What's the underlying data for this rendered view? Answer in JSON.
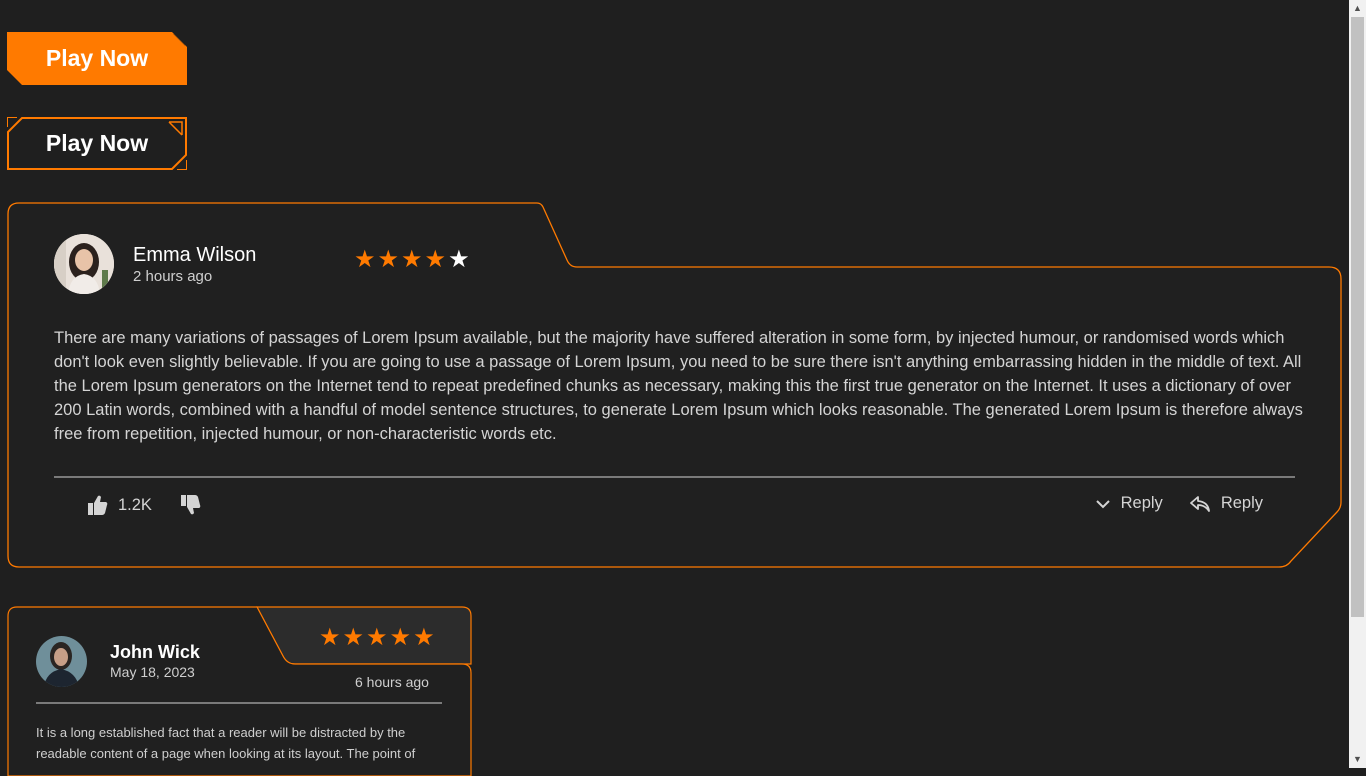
{
  "buttons": {
    "play_filled_label": "Play Now",
    "play_outline_label": "Play Now"
  },
  "colors": {
    "accent": "#ff7a00",
    "background": "#1f1f1f",
    "card_background": "#202020",
    "divider": "#7a7a7a"
  },
  "review1": {
    "name": "Emma Wilson",
    "time": "2 hours ago",
    "rating": 4,
    "rating_max": 5,
    "body": "There are many variations of passages of Lorem Ipsum available, but the majority have suffered alteration in some form, by injected humour, or randomised words which don't look even slightly believable. If you are going to use a passage of Lorem Ipsum, you need to be sure there isn't anything embarrassing hidden in the middle of text. All the Lorem Ipsum generators on the Internet tend to repeat predefined chunks as necessary, making this the first true generator on the Internet. It uses a dictionary of over 200 Latin words, combined with a handful of model sentence structures, to generate Lorem Ipsum which looks reasonable. The generated Lorem Ipsum is therefore always free from repetition, injected humour, or non-characteristic words etc.",
    "likes": "1.2K",
    "reply_toggle_label": "Reply",
    "reply_label": "Reply",
    "icons": [
      "avatar",
      "star-icon",
      "thumbs-up-icon",
      "thumbs-down-icon",
      "chevron-down-icon",
      "reply-arrow-icon"
    ]
  },
  "review2": {
    "name": "John Wick",
    "date": "May 18, 2023",
    "time": "6 hours ago",
    "rating": 5,
    "rating_max": 5,
    "body": "It is a long established fact that a reader will be distracted by the readable content of a page when looking at its layout. The point of"
  }
}
